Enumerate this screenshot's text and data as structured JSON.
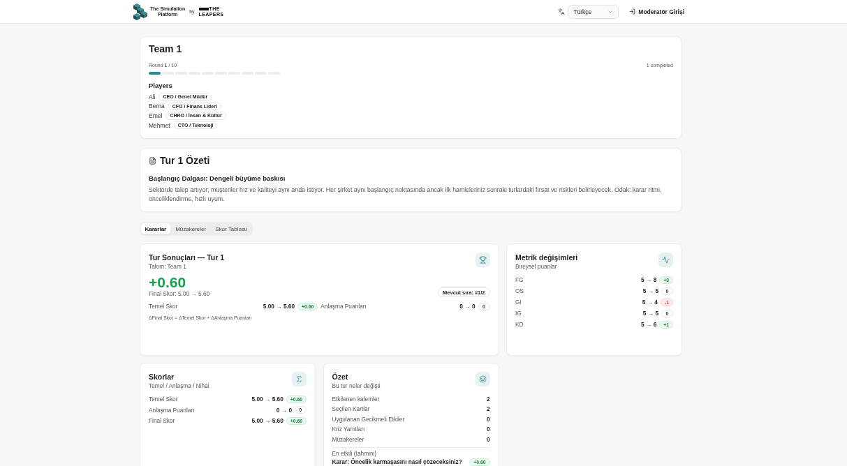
{
  "header": {
    "brand": {
      "name": "The Simulation\nPlatform",
      "by": "by",
      "partner_top": "THE",
      "partner_bottom": "LEAPERS"
    },
    "language": {
      "value": "Türkçe"
    },
    "login": "Moderatör Girişi"
  },
  "team": {
    "title": "Team 1",
    "round": "Round **1** / 10",
    "completed": "1 completed",
    "progress": [
      {
        "done": true
      },
      {
        "done": false
      },
      {
        "done": false
      },
      {
        "done": false
      },
      {
        "done": false
      },
      {
        "done": false
      },
      {
        "done": false
      },
      {
        "done": false
      },
      {
        "done": false
      },
      {
        "done": false
      }
    ],
    "players_title": "Players",
    "players": [
      {
        "name": "Ali",
        "role": "CEO / Genel Müdür"
      },
      {
        "name": "Berna",
        "role": "CFO / Finans Lideri"
      },
      {
        "name": "Emel",
        "role": "CHRO / İnsan & Kültür"
      },
      {
        "name": "Mehmet",
        "role": "CTO / Teknoloji"
      }
    ]
  },
  "round_summary": {
    "title": "Tur 1 Özeti",
    "headline": "Başlangıç Dalgası: Dengeli büyüme baskısı",
    "text": "Sektörde talep artıyor; müşteriler hız ve kaliteyi aynı anda istiyor. Her şirket aynı başlangıç noktasında ancak ilk hamleleriniz sonraki turlardaki fırsat ve riskleri belirleyecek. Odak: karar ritmi, önceliklendirme, hızlı uyum."
  },
  "tabs": [
    {
      "label": "Kararlar",
      "selected": true
    },
    {
      "label": "Müzakereler",
      "selected": false
    },
    {
      "label": "Skor Tablosu",
      "selected": false
    }
  ],
  "results": {
    "title": "Tur Sonuçları — Tur 1",
    "subtitle": "Takım: Team 1",
    "delta": {
      "text": "+0.60",
      "kind": "up"
    },
    "final": "Final Skor: 5.00 → 5.60",
    "rank": "Mevcut sıra: #1/2",
    "rows": [
      {
        "label": "Temel Skor",
        "change": "5.00 → 5.60",
        "delta": "+0.60",
        "kind": "up"
      },
      {
        "label": "Anlaşma Puanları",
        "change": "0 → 0",
        "delta": "0",
        "kind": "flat"
      }
    ],
    "formula": "ΔFinal Skor = ΔTemel Skor + ΔAnlaşma Puanları"
  },
  "metrics": {
    "title": "Metrik değişimleri",
    "subtitle": "Bireysel puanlar",
    "rows": [
      {
        "label": "FG",
        "change": "5 → 8",
        "delta": "+3",
        "kind": "up"
      },
      {
        "label": "OS",
        "change": "5 → 5",
        "delta": "0",
        "kind": "flat"
      },
      {
        "label": "GI",
        "change": "5 → 4",
        "delta": "-1",
        "kind": "down"
      },
      {
        "label": "IG",
        "change": "5 → 5",
        "delta": "0",
        "kind": "flat"
      },
      {
        "label": "KD",
        "change": "5 → 6",
        "delta": "+1",
        "kind": "up"
      }
    ]
  },
  "scores": {
    "title": "Skorlar",
    "subtitle": "Temel / Anlaşma / Nihai",
    "rows": [
      {
        "label": "Temel Skor",
        "change": "5.00 → 5.60",
        "delta": "+0.60",
        "kind": "up"
      },
      {
        "label": "Anlaşma Puanları",
        "change": "0 → 0",
        "delta": "0",
        "kind": "flat"
      },
      {
        "label": "Final Skor",
        "change": "5.00 → 5.60",
        "delta": "+0.60",
        "kind": "up"
      }
    ]
  },
  "overview": {
    "title": "Özet",
    "subtitle": "Bu tur neler değişti",
    "rows": [
      {
        "label": "Etkilenen kalemler",
        "value": "2"
      },
      {
        "label": "Seçilen Kartlar",
        "value": "2"
      },
      {
        "label": "Uygulanan Gecikmeli Etkiler",
        "value": "0"
      },
      {
        "label": "Kriz Yanıtları",
        "value": "0"
      },
      {
        "label": "Müzakereler",
        "value": "0"
      }
    ],
    "most_effective_label": "En etkili (tahmini)",
    "top_decision": {
      "label": "Karar: Öncelik karmaşasını nasıl çözeceksiniz?",
      "delta": "+0.60",
      "kind": "up"
    }
  }
}
